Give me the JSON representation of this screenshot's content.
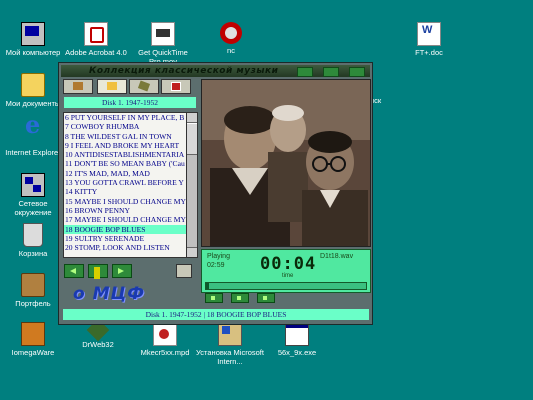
{
  "desktop": {
    "icons": [
      {
        "label": "Мой компьютер"
      },
      {
        "label": "Adobe Acrobat 4.0"
      },
      {
        "label": "Get QuickTime Pro.mov"
      },
      {
        "label": "nc"
      },
      {
        "label": "FT+.doc"
      },
      {
        "label": "Мои документы"
      },
      {
        "label": "Internet Explorer"
      },
      {
        "label": "Сетевое окружение"
      },
      {
        "label": "Корзина"
      },
      {
        "label": "Портфель"
      },
      {
        "label": "IomegaWare"
      },
      {
        "label": "DrWeb32"
      },
      {
        "label": "Mkecr5xx.mpd"
      },
      {
        "label": "Установка Microsoft Intern..."
      },
      {
        "label": "56x_9x.exe"
      },
      {
        "label": "Диск"
      }
    ]
  },
  "player": {
    "title": "Коллекция классической музыки",
    "disk_title": "Disk 1. 1947-1952",
    "tracks": [
      "6 PUT YOURSELF IN MY PLACE, B",
      "7 COWBOY RHUMBA",
      "8 THE WILDEST GAL IN TOWN",
      "9 I FEEL AND BROKE MY HEART",
      "10 ANTIDISESTABLISHMENTARIA",
      "11 DON'T BE SO MEAN BABY ('Cau",
      "12 IT'S MAD, MAD, MAD",
      "13 YOU GOTTA CRAWL BEFORE Y",
      "14 KITTY",
      "15 MAYBE I SHOULD CHANGE MY",
      "16 BROWN PENNY",
      "17 MAYBE I SHOULD CHANGE MY",
      "18 BOOGIE BOP BLUES",
      "19 SULTRY SERENADE",
      "20 STOMP, LOOK AND LISTEN"
    ],
    "selected_index": 12,
    "logo": "о МЦФ",
    "display": {
      "state": "Playing",
      "total_time": "02:59",
      "current_time": "00:04",
      "time_label": "time",
      "file": "D1t18.wav",
      "progress": 0.02
    },
    "status": "Disk 1. 1947-1952 | 18 BOOGIE BOP BLUES"
  }
}
